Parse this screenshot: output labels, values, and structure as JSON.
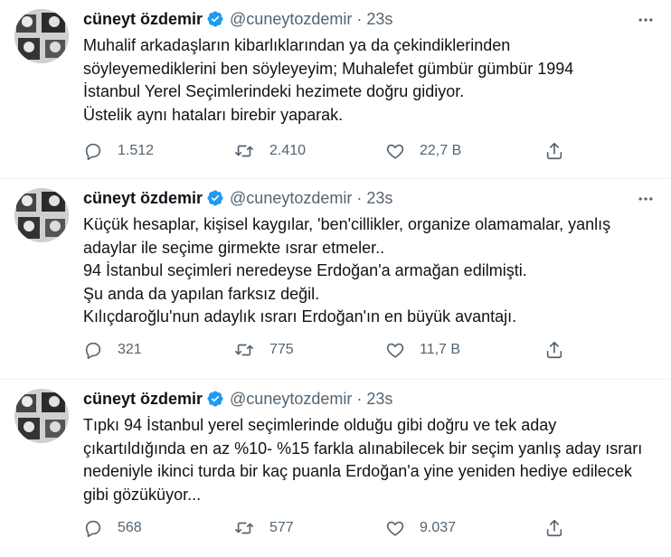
{
  "tweets": [
    {
      "name": "cüneyt özdemir",
      "handle": "@cuneytozdemir",
      "sep": "·",
      "time": "23s",
      "lines": [
        "Muhalif arkadaşların kibarlıklarından ya da çekindiklerinden",
        "söyleyemediklerini ben söyleyeyim; Muhalefet gümbür gümbür 1994",
        "İstanbul Yerel Seçimlerindeki hezimete doğru gidiyor.",
        "Üstelik aynı hataları birebir yaparak."
      ],
      "replies": "1.512",
      "retweets": "2.410",
      "likes": "22,7 B"
    },
    {
      "name": "cüneyt özdemir",
      "handle": "@cuneytozdemir",
      "sep": "·",
      "time": "23s",
      "lines": [
        "Küçük hesaplar, kişisel kaygılar, 'ben'cillikler, organize olamamalar, yanlış",
        "adaylar ile seçime girmekte ısrar etmeler..",
        "94 İstanbul seçimleri neredeyse Erdoğan'a armağan edilmişti.",
        "Şu anda da yapılan farksız değil.",
        "Kılıçdaroğlu'nun adaylık ısrarı Erdoğan'ın en büyük avantajı."
      ],
      "replies": "321",
      "retweets": "775",
      "likes": "11,7 B"
    },
    {
      "name": "cüneyt özdemir",
      "handle": "@cuneytozdemir",
      "sep": "·",
      "time": "23s",
      "lines": [
        "Tıpkı 94 İstanbul yerel seçimlerinde olduğu gibi doğru ve tek aday",
        "çıkartıldığında en az %10- %15 farkla alınabilecek bir seçim yanlış aday ısrarı",
        "nedeniyle ikinci turda bir kaç puanla Erdoğan'a yine yeniden hediye edilecek",
        "gibi gözüküyor..."
      ],
      "replies": "568",
      "retweets": "577",
      "likes": "9.037"
    }
  ],
  "icons": {
    "verified": "verified-badge-icon",
    "more": "more-options-icon",
    "reply": "reply-icon",
    "retweet": "retweet-icon",
    "like": "like-icon",
    "share": "share-icon"
  },
  "colors": {
    "text": "#0f1419",
    "secondary": "#536471",
    "verified": "#1d9bf0",
    "divider": "#eff3f4"
  }
}
